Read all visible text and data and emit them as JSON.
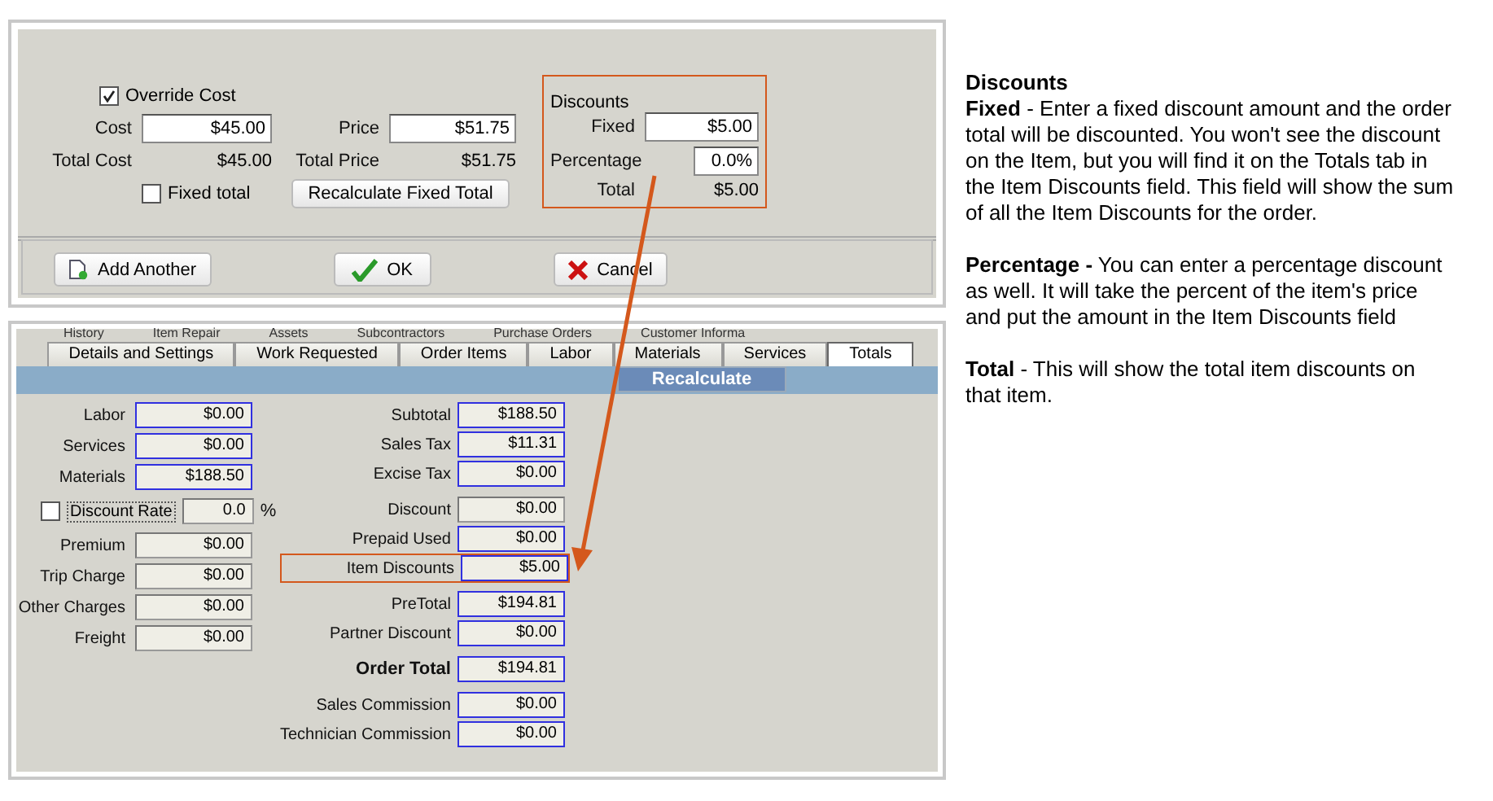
{
  "item_dialog": {
    "override_cost": {
      "label": "Override Cost",
      "checked": true
    },
    "cost": {
      "label": "Cost",
      "value": "$45.00"
    },
    "price": {
      "label": "Price",
      "value": "$51.75"
    },
    "total_cost": {
      "label": "Total Cost",
      "value": "$45.00"
    },
    "total_price": {
      "label": "Total Price",
      "value": "$51.75"
    },
    "fixed_total": {
      "label": "Fixed total",
      "checked": false
    },
    "recalculate_button": "Recalculate Fixed Total",
    "discounts": {
      "title": "Discounts",
      "fixed": {
        "label": "Fixed",
        "value": "$5.00"
      },
      "percentage": {
        "label": "Percentage",
        "value": "0.0%"
      },
      "total": {
        "label": "Total",
        "value": "$5.00"
      }
    },
    "buttons": [
      {
        "label": "Add Another",
        "kind": "add"
      },
      {
        "label": "OK",
        "kind": "ok"
      },
      {
        "label": "Cancel",
        "kind": "cancel"
      }
    ]
  },
  "work_order": {
    "back_tabs": [
      "History",
      "Item Repair",
      "Assets",
      "Subcontractors",
      "Purchase Orders",
      "Customer Informa"
    ],
    "tabs": [
      {
        "label": "Details and Settings",
        "selected": false
      },
      {
        "label": "Work Requested",
        "selected": false
      },
      {
        "label": "Order Items",
        "selected": false
      },
      {
        "label": "Labor",
        "selected": false
      },
      {
        "label": "Materials",
        "selected": false
      },
      {
        "label": "Services",
        "selected": false
      },
      {
        "label": "Totals",
        "selected": true
      }
    ],
    "recalculate_button": "Recalculate",
    "costs": [
      {
        "label": "Labor",
        "value": "$0.00",
        "kind": "computed"
      },
      {
        "label": "Services",
        "value": "$0.00",
        "kind": "computed"
      },
      {
        "label": "Materials",
        "value": "$188.50",
        "kind": "computed"
      }
    ],
    "discount_rate": {
      "label": "Discount Rate",
      "checked": false,
      "value": "0.0",
      "unit": "%"
    },
    "charges": [
      {
        "label": "Premium",
        "value": "$0.00",
        "kind": "input"
      },
      {
        "label": "Trip Charge",
        "value": "$0.00",
        "kind": "input"
      },
      {
        "label": "Other Charges",
        "value": "$0.00",
        "kind": "input"
      },
      {
        "label": "Freight",
        "value": "$0.00",
        "kind": "input"
      }
    ],
    "summary_groups": [
      [
        {
          "label": "Subtotal",
          "value": "$188.50",
          "kind": "computed",
          "bold": false,
          "highlighted": false
        },
        {
          "label": "Sales Tax",
          "value": "$11.31",
          "kind": "computed",
          "bold": false,
          "highlighted": false
        },
        {
          "label": "Excise Tax",
          "value": "$0.00",
          "kind": "computed",
          "bold": false,
          "highlighted": false
        }
      ],
      [
        {
          "label": "Discount",
          "value": "$0.00",
          "kind": "input",
          "bold": false,
          "highlighted": false
        },
        {
          "label": "Prepaid Used",
          "value": "$0.00",
          "kind": "computed",
          "bold": false,
          "highlighted": false
        },
        {
          "label": "Item Discounts",
          "value": "$5.00",
          "kind": "computed",
          "bold": false,
          "highlighted": true
        }
      ],
      [
        {
          "label": "PreTotal",
          "value": "$194.81",
          "kind": "computed",
          "bold": false,
          "highlighted": false
        },
        {
          "label": "Partner Discount",
          "value": "$0.00",
          "kind": "computed",
          "bold": false,
          "highlighted": false
        }
      ],
      [
        {
          "label": "Order Total",
          "value": "$194.81",
          "kind": "computed",
          "bold": true,
          "highlighted": false
        }
      ],
      [
        {
          "label": "Sales Commission",
          "value": "$0.00",
          "kind": "computed",
          "bold": false,
          "highlighted": false
        },
        {
          "label": "Technician Commission",
          "value": "$0.00",
          "kind": "computed",
          "bold": false,
          "highlighted": false
        }
      ]
    ]
  },
  "explanation": {
    "heading": "Discounts",
    "paragraphs": [
      "**Fixed** - Enter a fixed discount amount and the order total will be discounted. You won't see the discount on the Item, but you will find it on the Totals tab in the Item Discounts field. This field will show the sum of all the Item Discounts for the order.",
      "**Percentage -** You can enter a percentage discount as well. It will take the percent of the item's price and put the amount in the Item Discounts field",
      "**Total** - This will show the total item discounts on that item."
    ]
  }
}
